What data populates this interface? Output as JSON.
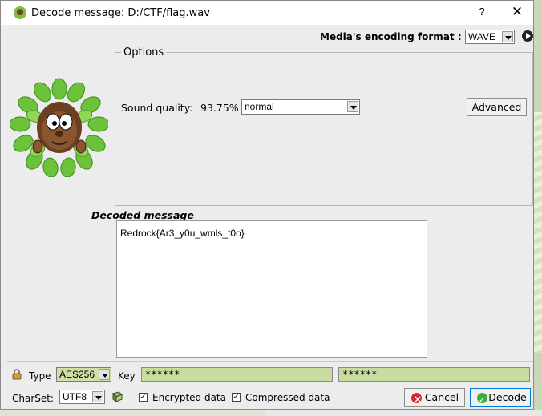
{
  "window": {
    "title": "Decode message: D:/CTF/flag.wav",
    "help_glyph": "?",
    "close_glyph": "✕"
  },
  "encoding": {
    "label": "Media's encoding format :",
    "selected": "WAVE"
  },
  "options": {
    "legend": "Options",
    "sound_quality_label": "Sound quality:",
    "sound_quality_value": "93.75%",
    "quality_selected": "normal",
    "advanced_button": "Advanced"
  },
  "decoded": {
    "label": "Decoded message",
    "text": "Redrock{Ar3_y0u_wmls_t0o}"
  },
  "crypto": {
    "type_label": "Type",
    "type_selected": "AES256",
    "key_label": "Key",
    "key_value": "******",
    "key_confirm": "******"
  },
  "footer": {
    "charset_label": "CharSet:",
    "charset_selected": "UTF8",
    "encrypted_label": "Encrypted data",
    "encrypted_checked": true,
    "compressed_label": "Compressed data",
    "compressed_checked": true,
    "check_glyph": "✓",
    "cancel_button": "Cancel",
    "decode_button": "Decode"
  },
  "colors": {
    "password_field": "#c7dc9e",
    "type_field": "#cfe0a6",
    "focus_border": "#0078d7"
  }
}
